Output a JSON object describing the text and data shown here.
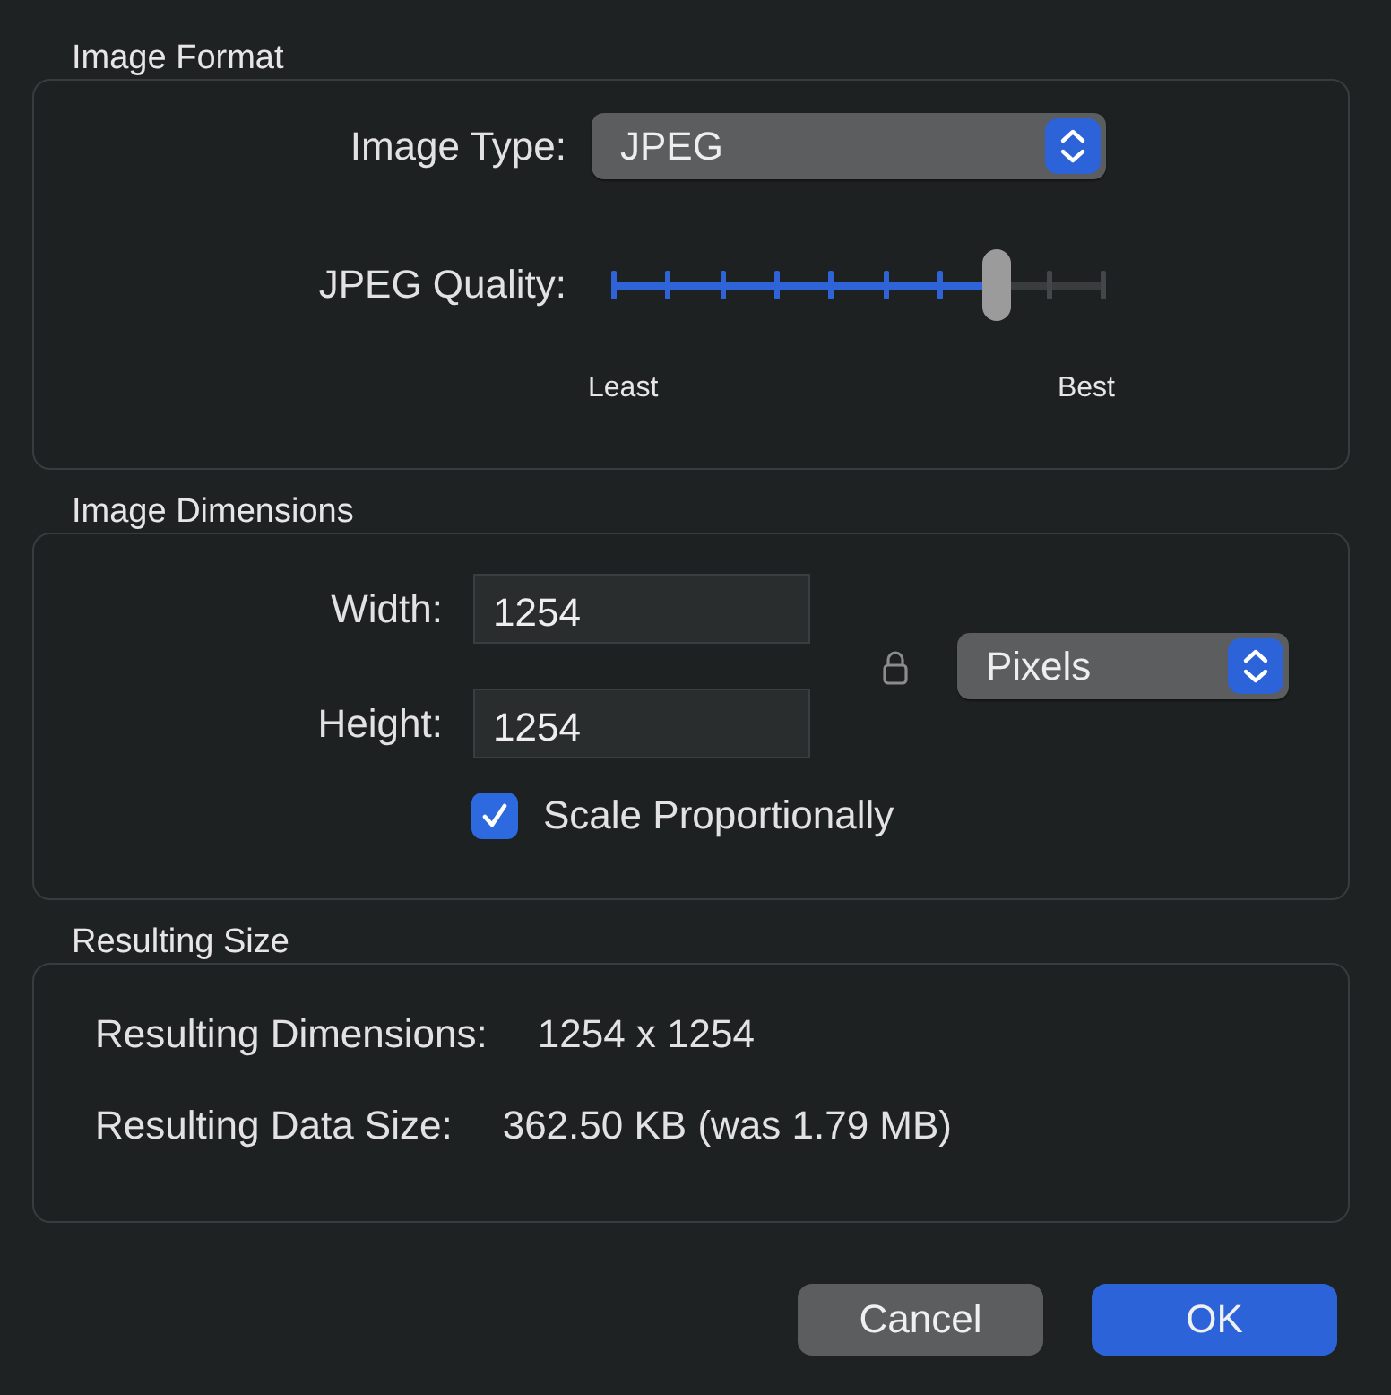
{
  "image_format": {
    "title": "Image Format",
    "image_type": {
      "label": "Image Type:",
      "value": "JPEG"
    },
    "quality": {
      "label": "JPEG Quality:",
      "level": 0.78,
      "min_label": "Least",
      "max_label": "Best"
    }
  },
  "image_dimensions": {
    "title": "Image Dimensions",
    "width": {
      "label": "Width:",
      "value": "1254"
    },
    "height": {
      "label": "Height:",
      "value": "1254"
    },
    "units": {
      "value": "Pixels"
    },
    "scale": {
      "label": "Scale Proportionally",
      "checked": true
    }
  },
  "resulting_size": {
    "title": "Resulting Size",
    "rows": [
      {
        "label": "Resulting Dimensions:",
        "value": "1254 x 1254"
      },
      {
        "label": "Resulting Data Size:",
        "value": "362.50 KB (was 1.79 MB)"
      }
    ]
  },
  "buttons": [
    {
      "label": "Cancel",
      "kind": "secondary"
    },
    {
      "label": "OK",
      "kind": "default"
    }
  ]
}
